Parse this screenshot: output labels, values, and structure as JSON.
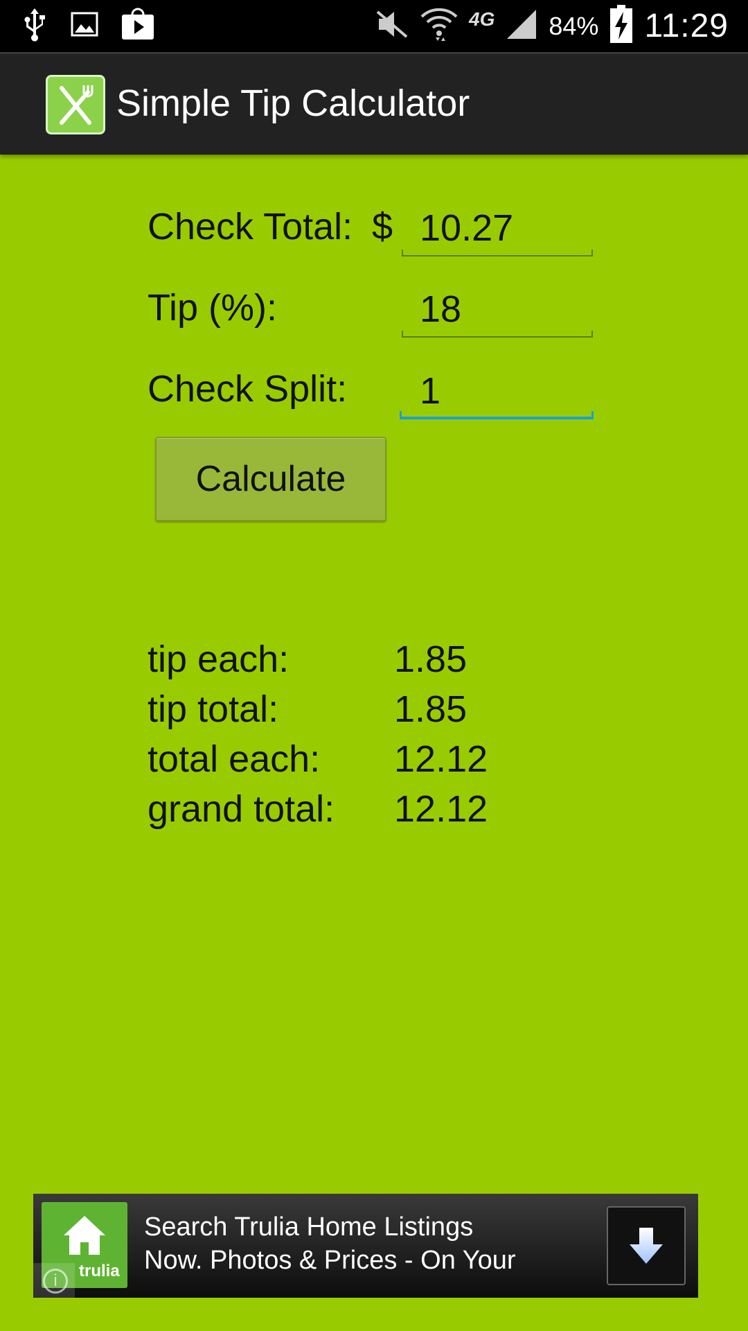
{
  "status_bar": {
    "battery_percent": "84%",
    "time": "11:29",
    "network": "4G",
    "icons": [
      "usb-icon",
      "image-icon",
      "store-icon",
      "mute-icon",
      "wifi-icon",
      "signal-icon",
      "battery-charging-icon"
    ]
  },
  "app_bar": {
    "title": "Simple Tip Calculator",
    "icon": "fork-knife-icon"
  },
  "form": {
    "check_total_label": "Check Total:",
    "currency_symbol": "$",
    "check_total_value": "10.27",
    "tip_label": "Tip (%):",
    "tip_value": "18",
    "split_label": "Check Split:",
    "split_value": "1",
    "calculate_label": "Calculate"
  },
  "results": {
    "tip_each_label": "tip each:",
    "tip_each_value": "1.85",
    "tip_total_label": "tip total:",
    "tip_total_value": "1.85",
    "total_each_label": "total each:",
    "total_each_value": "12.12",
    "grand_total_label": "grand total:",
    "grand_total_value": "12.12"
  },
  "ad": {
    "brand": "trulia",
    "line1": "Search Trulia Home Listings",
    "line2": "Now. Photos & Prices - On Your",
    "info_label": "i"
  },
  "colors": {
    "background": "#99cc00",
    "app_bar": "#222222",
    "focus_underline": "#1e9fd6"
  }
}
